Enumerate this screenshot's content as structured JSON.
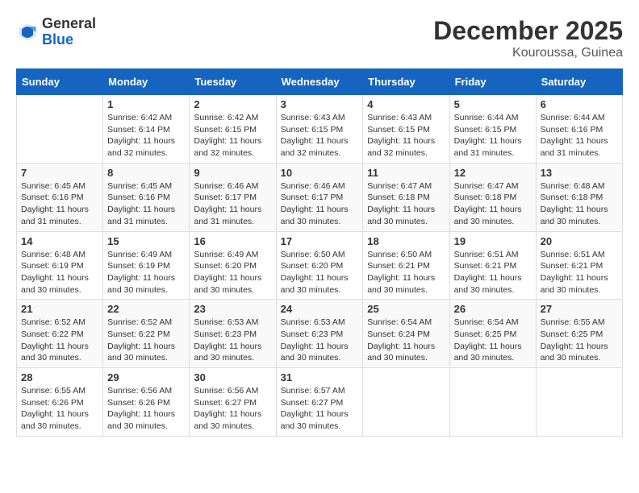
{
  "logo": {
    "general": "General",
    "blue": "Blue"
  },
  "title": "December 2025",
  "location": "Kouroussa, Guinea",
  "days_of_week": [
    "Sunday",
    "Monday",
    "Tuesday",
    "Wednesday",
    "Thursday",
    "Friday",
    "Saturday"
  ],
  "weeks": [
    [
      {
        "day": "",
        "sunrise": "",
        "sunset": "",
        "daylight": ""
      },
      {
        "day": "1",
        "sunrise": "Sunrise: 6:42 AM",
        "sunset": "Sunset: 6:14 PM",
        "daylight": "Daylight: 11 hours and 32 minutes."
      },
      {
        "day": "2",
        "sunrise": "Sunrise: 6:42 AM",
        "sunset": "Sunset: 6:15 PM",
        "daylight": "Daylight: 11 hours and 32 minutes."
      },
      {
        "day": "3",
        "sunrise": "Sunrise: 6:43 AM",
        "sunset": "Sunset: 6:15 PM",
        "daylight": "Daylight: 11 hours and 32 minutes."
      },
      {
        "day": "4",
        "sunrise": "Sunrise: 6:43 AM",
        "sunset": "Sunset: 6:15 PM",
        "daylight": "Daylight: 11 hours and 32 minutes."
      },
      {
        "day": "5",
        "sunrise": "Sunrise: 6:44 AM",
        "sunset": "Sunset: 6:15 PM",
        "daylight": "Daylight: 11 hours and 31 minutes."
      },
      {
        "day": "6",
        "sunrise": "Sunrise: 6:44 AM",
        "sunset": "Sunset: 6:16 PM",
        "daylight": "Daylight: 11 hours and 31 minutes."
      }
    ],
    [
      {
        "day": "7",
        "sunrise": "Sunrise: 6:45 AM",
        "sunset": "Sunset: 6:16 PM",
        "daylight": "Daylight: 11 hours and 31 minutes."
      },
      {
        "day": "8",
        "sunrise": "Sunrise: 6:45 AM",
        "sunset": "Sunset: 6:16 PM",
        "daylight": "Daylight: 11 hours and 31 minutes."
      },
      {
        "day": "9",
        "sunrise": "Sunrise: 6:46 AM",
        "sunset": "Sunset: 6:17 PM",
        "daylight": "Daylight: 11 hours and 31 minutes."
      },
      {
        "day": "10",
        "sunrise": "Sunrise: 6:46 AM",
        "sunset": "Sunset: 6:17 PM",
        "daylight": "Daylight: 11 hours and 30 minutes."
      },
      {
        "day": "11",
        "sunrise": "Sunrise: 6:47 AM",
        "sunset": "Sunset: 6:18 PM",
        "daylight": "Daylight: 11 hours and 30 minutes."
      },
      {
        "day": "12",
        "sunrise": "Sunrise: 6:47 AM",
        "sunset": "Sunset: 6:18 PM",
        "daylight": "Daylight: 11 hours and 30 minutes."
      },
      {
        "day": "13",
        "sunrise": "Sunrise: 6:48 AM",
        "sunset": "Sunset: 6:18 PM",
        "daylight": "Daylight: 11 hours and 30 minutes."
      }
    ],
    [
      {
        "day": "14",
        "sunrise": "Sunrise: 6:48 AM",
        "sunset": "Sunset: 6:19 PM",
        "daylight": "Daylight: 11 hours and 30 minutes."
      },
      {
        "day": "15",
        "sunrise": "Sunrise: 6:49 AM",
        "sunset": "Sunset: 6:19 PM",
        "daylight": "Daylight: 11 hours and 30 minutes."
      },
      {
        "day": "16",
        "sunrise": "Sunrise: 6:49 AM",
        "sunset": "Sunset: 6:20 PM",
        "daylight": "Daylight: 11 hours and 30 minutes."
      },
      {
        "day": "17",
        "sunrise": "Sunrise: 6:50 AM",
        "sunset": "Sunset: 6:20 PM",
        "daylight": "Daylight: 11 hours and 30 minutes."
      },
      {
        "day": "18",
        "sunrise": "Sunrise: 6:50 AM",
        "sunset": "Sunset: 6:21 PM",
        "daylight": "Daylight: 11 hours and 30 minutes."
      },
      {
        "day": "19",
        "sunrise": "Sunrise: 6:51 AM",
        "sunset": "Sunset: 6:21 PM",
        "daylight": "Daylight: 11 hours and 30 minutes."
      },
      {
        "day": "20",
        "sunrise": "Sunrise: 6:51 AM",
        "sunset": "Sunset: 6:21 PM",
        "daylight": "Daylight: 11 hours and 30 minutes."
      }
    ],
    [
      {
        "day": "21",
        "sunrise": "Sunrise: 6:52 AM",
        "sunset": "Sunset: 6:22 PM",
        "daylight": "Daylight: 11 hours and 30 minutes."
      },
      {
        "day": "22",
        "sunrise": "Sunrise: 6:52 AM",
        "sunset": "Sunset: 6:22 PM",
        "daylight": "Daylight: 11 hours and 30 minutes."
      },
      {
        "day": "23",
        "sunrise": "Sunrise: 6:53 AM",
        "sunset": "Sunset: 6:23 PM",
        "daylight": "Daylight: 11 hours and 30 minutes."
      },
      {
        "day": "24",
        "sunrise": "Sunrise: 6:53 AM",
        "sunset": "Sunset: 6:23 PM",
        "daylight": "Daylight: 11 hours and 30 minutes."
      },
      {
        "day": "25",
        "sunrise": "Sunrise: 6:54 AM",
        "sunset": "Sunset: 6:24 PM",
        "daylight": "Daylight: 11 hours and 30 minutes."
      },
      {
        "day": "26",
        "sunrise": "Sunrise: 6:54 AM",
        "sunset": "Sunset: 6:25 PM",
        "daylight": "Daylight: 11 hours and 30 minutes."
      },
      {
        "day": "27",
        "sunrise": "Sunrise: 6:55 AM",
        "sunset": "Sunset: 6:25 PM",
        "daylight": "Daylight: 11 hours and 30 minutes."
      }
    ],
    [
      {
        "day": "28",
        "sunrise": "Sunrise: 6:55 AM",
        "sunset": "Sunset: 6:26 PM",
        "daylight": "Daylight: 11 hours and 30 minutes."
      },
      {
        "day": "29",
        "sunrise": "Sunrise: 6:56 AM",
        "sunset": "Sunset: 6:26 PM",
        "daylight": "Daylight: 11 hours and 30 minutes."
      },
      {
        "day": "30",
        "sunrise": "Sunrise: 6:56 AM",
        "sunset": "Sunset: 6:27 PM",
        "daylight": "Daylight: 11 hours and 30 minutes."
      },
      {
        "day": "31",
        "sunrise": "Sunrise: 6:57 AM",
        "sunset": "Sunset: 6:27 PM",
        "daylight": "Daylight: 11 hours and 30 minutes."
      },
      {
        "day": "",
        "sunrise": "",
        "sunset": "",
        "daylight": ""
      },
      {
        "day": "",
        "sunrise": "",
        "sunset": "",
        "daylight": ""
      },
      {
        "day": "",
        "sunrise": "",
        "sunset": "",
        "daylight": ""
      }
    ]
  ]
}
